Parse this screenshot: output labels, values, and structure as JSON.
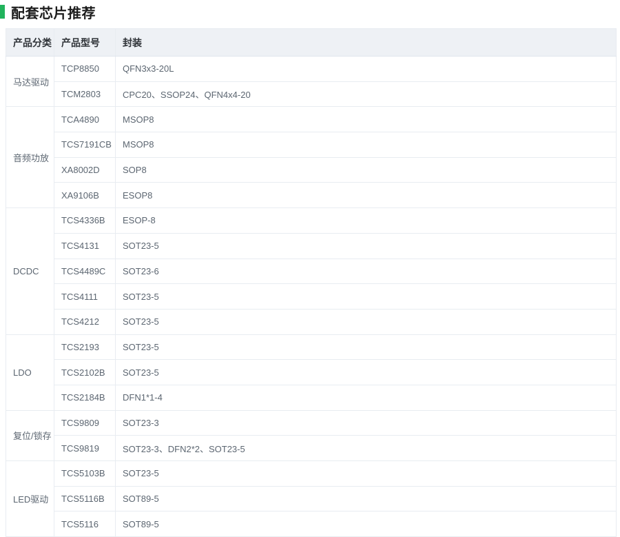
{
  "page": {
    "title": "配套芯片推荐",
    "accent_color": "#21b35c"
  },
  "table": {
    "headers": [
      "产品分类",
      "产品型号",
      "封装"
    ],
    "groups": [
      {
        "category": "马达驱动",
        "rows": [
          [
            "TCP8850",
            "QFN3x3-20L"
          ],
          [
            "TCM2803",
            "CPC20、SSOP24、QFN4x4-20"
          ]
        ]
      },
      {
        "category": "音频功放",
        "rows": [
          [
            "TCA4890",
            "MSOP8"
          ],
          [
            "TCS7191CB",
            "MSOP8"
          ],
          [
            "XA8002D",
            "SOP8"
          ],
          [
            "XA9106B",
            "ESOP8"
          ]
        ]
      },
      {
        "category": "DCDC",
        "rows": [
          [
            "TCS4336B",
            "ESOP-8"
          ],
          [
            "TCS4131",
            "SOT23-5"
          ],
          [
            "TCS4489C",
            "SOT23-6"
          ],
          [
            "TCS4111",
            "SOT23-5"
          ],
          [
            "TCS4212",
            "SOT23-5"
          ]
        ]
      },
      {
        "category": "LDO",
        "rows": [
          [
            "TCS2193",
            "SOT23-5"
          ],
          [
            "TCS2102B",
            "SOT23-5"
          ],
          [
            "TCS2184B",
            "DFN1*1-4"
          ]
        ]
      },
      {
        "category": "复位/锁存",
        "rows": [
          [
            "TCS9809",
            "SOT23-3"
          ],
          [
            "TCS9819",
            "SOT23-3、DFN2*2、SOT23-5"
          ]
        ]
      },
      {
        "category": "LED驱动",
        "rows": [
          [
            "TCS5103B",
            "SOT23-5"
          ],
          [
            "TCS5116B",
            "SOT89-5"
          ],
          [
            "TCS5116",
            "SOT89-5"
          ]
        ]
      }
    ]
  }
}
